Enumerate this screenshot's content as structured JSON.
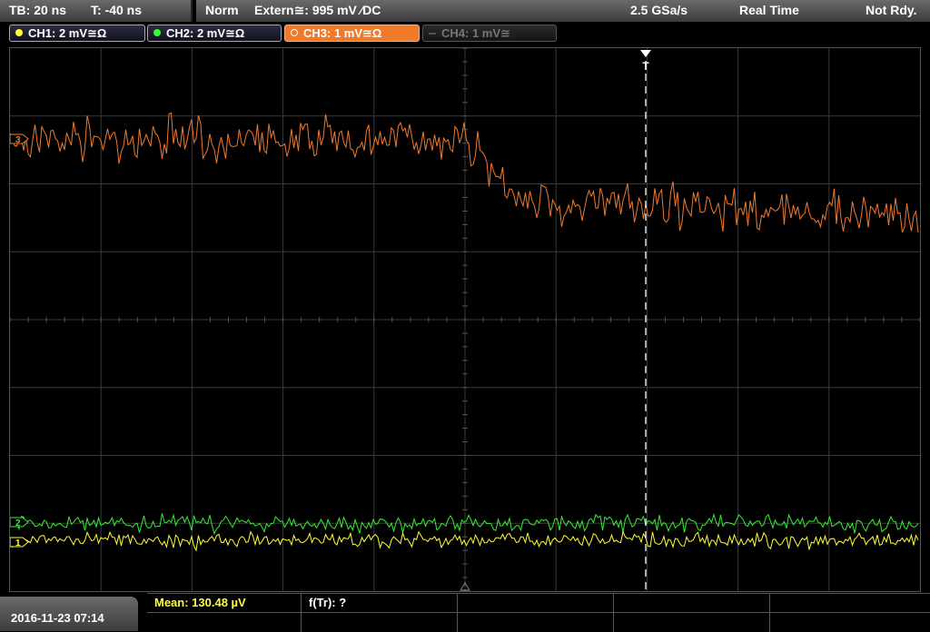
{
  "timebase": {
    "tb": "TB: 20 ns",
    "trigger_offset": "T: -40 ns"
  },
  "status": {
    "mode": "Norm",
    "trigger": "Extern≅: 995 mV ⁄DC",
    "sample_rate": "2.5 GSa/s",
    "acq_mode": "Real Time",
    "state": "Not Rdy."
  },
  "channels": [
    {
      "label": "CH1: 2 mV≅Ω",
      "color": "#ffff33"
    },
    {
      "label": "CH2: 2 mV≅Ω",
      "color": "#33ff33"
    },
    {
      "label": "CH3: 1 mV≅Ω",
      "color": "#f07a2c"
    },
    {
      "label": "CH4: 1 mV≅",
      "color": "#666666"
    }
  ],
  "markers": {
    "trigger_marker": "T",
    "ch3_marker": "3",
    "ch2_marker": "2",
    "ch1_marker": "1"
  },
  "datetime": "2016-11-23 07:14",
  "measurements": {
    "mean": "Mean: 130.48 µV",
    "freq": "f(Tr): ?"
  },
  "colors": {
    "grid": "#3a3a3a",
    "ch1": "#ffff33",
    "ch2": "#33ee33",
    "ch3": "#f07a2c",
    "trigger_line": "#ffffff"
  }
}
